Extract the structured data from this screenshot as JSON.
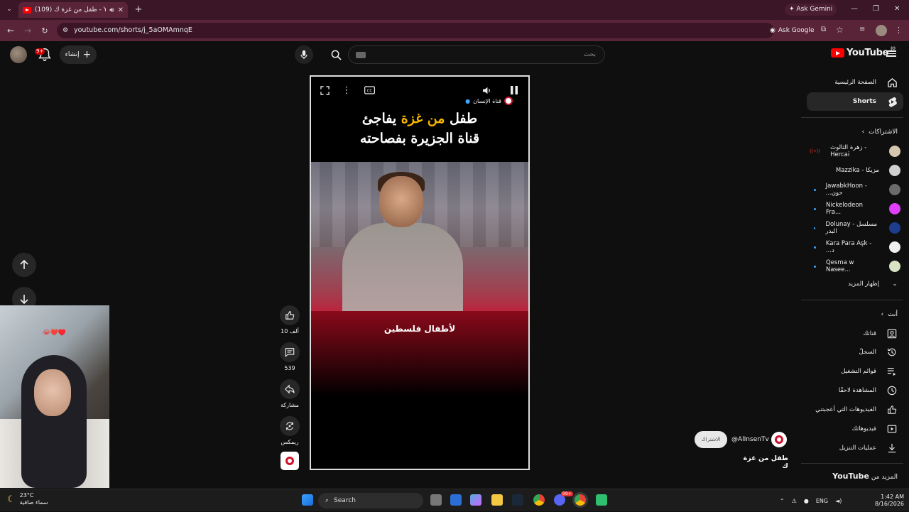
{
  "browser": {
    "tab_title": "(109) طفل من غزة ك - YouTube",
    "url": "youtube.com/shorts/j_5aOMAmnqE",
    "ask_google": "Ask Google",
    "ask_gemini": "Ask Gemini"
  },
  "header": {
    "search_placeholder": "بحث",
    "create_label": "إنشاء",
    "notifications_badge": "9+",
    "logo_text": "YouTube",
    "logo_country": "JO"
  },
  "sidebar": {
    "main": [
      {
        "label": "الصفحة الرئيسية",
        "icon": "home-icon"
      },
      {
        "label": "Shorts",
        "icon": "shorts-icon",
        "active": true
      }
    ],
    "subscriptions_header": "الاشتراكات",
    "subscriptions": [
      {
        "label": "زهرة الثالوث - Hercai",
        "live": true,
        "color": "#d5c6b0"
      },
      {
        "label": "Mazzika - مزيكا",
        "color": "#cfcfcf"
      },
      {
        "label": "JawabkHoon - ...حون",
        "dot": true,
        "color": "#6b6b6b"
      },
      {
        "label": "Nickelodeon Fra...",
        "dot": true,
        "color": "#e040fb"
      },
      {
        "label": "Dolunay - مسلسل البدر",
        "dot": true,
        "color": "#1e3d8f"
      },
      {
        "label": "Kara Para Aşk - ...د",
        "dot": true,
        "color": "#f0f0f0"
      },
      {
        "label": "Qesma w Nasee...",
        "dot": true,
        "color": "#d7e3c2"
      }
    ],
    "show_more": "إظهار المزيد",
    "you_header": "أنت",
    "you_items": [
      {
        "label": "قناتك",
        "icon": "channel-icon"
      },
      {
        "label": "السجلّ",
        "icon": "history-icon"
      },
      {
        "label": "قوائم التشغيل",
        "icon": "playlist-icon"
      },
      {
        "label": "المشاهدة لاحقًا",
        "icon": "clock-icon"
      },
      {
        "label": "الفيديوهات التي أعجبتني",
        "icon": "like-icon"
      },
      {
        "label": "فيديوهاتك",
        "icon": "video-icon"
      },
      {
        "label": "عمليات التنزيل",
        "icon": "download-icon"
      }
    ],
    "more_from": "المزيد من",
    "more_from_brand": "YouTube"
  },
  "video": {
    "title_line1_a": "طفل ",
    "title_line1_hl": "من غزة",
    "title_line1_b": " يفاجئ",
    "title_line2": "قناة الجزيرة بفصاحته",
    "channel_tag": "قناة الإنسان",
    "caption": "لأطفال فلسطين",
    "progress": 0.3
  },
  "actions": {
    "likes": "10 ألف",
    "comments": "539",
    "share": "مشاركة",
    "remix": "ريمكس"
  },
  "channel": {
    "subscribe": "الاشتراك",
    "handle": "@AlInsenTv",
    "short_title": "طفل من غزة ك"
  },
  "webcam": {
    "overlay": "😭❤️♥️"
  },
  "taskbar": {
    "temp": "23°C",
    "weather": "سماء صافية",
    "search": "Search",
    "lang": "ENG",
    "time": "1:42 AM",
    "date": "8/16/2026",
    "discord_badge": "99+"
  }
}
